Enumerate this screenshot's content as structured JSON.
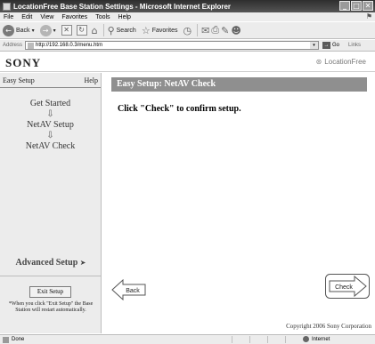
{
  "window": {
    "title": "LocationFree Base Station Settings - Microsoft Internet Explorer",
    "controls": [
      "_",
      "□",
      "✕"
    ]
  },
  "menu": [
    "File",
    "Edit",
    "View",
    "Favorites",
    "Tools",
    "Help"
  ],
  "toolbar": {
    "back_label": "Back",
    "search_label": "Search",
    "favorites_label": "Favorites"
  },
  "address": {
    "label": "Address",
    "url": "http://192.168.0.3/menu.htm",
    "go_label": "Go",
    "links_label": "Links"
  },
  "brand": {
    "sony": "SONY",
    "locationfree": "LocationFree"
  },
  "sidebar": {
    "title": "Easy Setup",
    "help": "Help",
    "steps": [
      "Get Started",
      "NetAV Setup",
      "NetAV Check"
    ],
    "advanced": "Advanced Setup",
    "exit_button": "Exit Setup",
    "exit_note": "*When you click \"Exit Setup\" the Base Station will restart automatically."
  },
  "main": {
    "heading": "Easy Setup: NetAV Check",
    "instruction": "Click \"Check\" to confirm setup.",
    "back_button": "Back",
    "check_button": "Check",
    "copyright": "Copyright 2006 Sony Corporation"
  },
  "status": {
    "text": "Done",
    "zone": "Internet"
  }
}
